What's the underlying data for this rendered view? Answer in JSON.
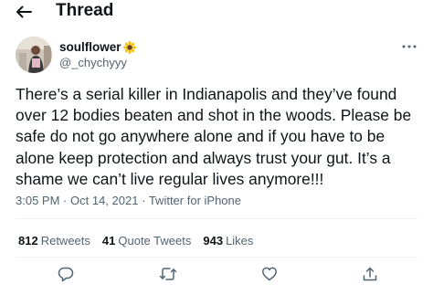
{
  "header": {
    "title": "Thread",
    "back_icon": "arrow-left-icon"
  },
  "tweet": {
    "display_name": "soulflower",
    "name_emoji_icon": "sunflower-icon",
    "handle": "@_chychyyy",
    "more_icon": "more-horizontal-icon",
    "text": "There’s a serial killer in Indianapolis and they’ve found over 12 bodies beaten and shot in the woods. Please be safe do not go anywhere alone and if you have to be alone keep protection and always trust your gut. It’s a shame we can’t live regular lives anymore!!!",
    "time": "3:05 PM",
    "separator": "·",
    "date": "Oct 14, 2021",
    "source": "Twitter for iPhone"
  },
  "stats": {
    "retweets_count": "812",
    "retweets_label": "Retweets",
    "quotes_count": "41",
    "quotes_label": "Quote Tweets",
    "likes_count": "943",
    "likes_label": "Likes"
  },
  "actions": {
    "reply_icon": "reply-icon",
    "retweet_icon": "retweet-icon",
    "like_icon": "heart-icon",
    "share_icon": "share-icon"
  },
  "colors": {
    "text": "#0f1419",
    "secondary": "#536471",
    "divider": "#eff3f4"
  }
}
